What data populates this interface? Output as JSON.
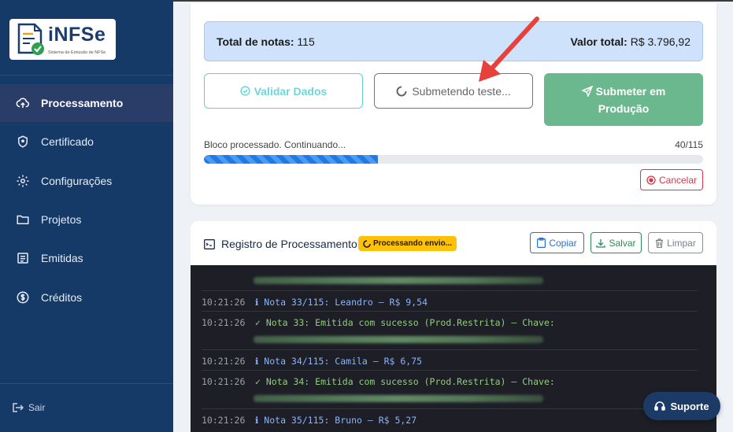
{
  "sidebar": {
    "logo": {
      "brand": "iNFSe",
      "subtitle": "Sistema de Emissão de NFSe"
    },
    "items": [
      {
        "label": "Processamento",
        "icon": "cloud-upload-icon",
        "active": true
      },
      {
        "label": "Certificado",
        "icon": "shield-icon"
      },
      {
        "label": "Configurações",
        "icon": "gear-icon"
      },
      {
        "label": "Projetos",
        "icon": "folder-icon"
      },
      {
        "label": "Emitidas",
        "icon": "list-icon"
      },
      {
        "label": "Créditos",
        "icon": "dollar-icon"
      }
    ],
    "logout_label": "Sair"
  },
  "summary": {
    "total_notas_label": "Total de notas:",
    "total_notas_value": "115",
    "valor_total_label": "Valor total:",
    "valor_total_value": "R$ 3.796,92"
  },
  "actions": {
    "validar_label": "Validar Dados",
    "teste_label": "Submetendo teste...",
    "producao_line1": "Submeter em",
    "producao_line2": "Produção"
  },
  "progress": {
    "status_text": "Bloco processado. Continuando...",
    "count_text": "40/115",
    "fraction": 0.348,
    "cancel_label": "Cancelar"
  },
  "log": {
    "title": "Registro de Processamento",
    "badge": "Processando envio...",
    "copy_label": "Copiar",
    "save_label": "Salvar",
    "clear_label": "Limpar",
    "entries": [
      {
        "time": "10:21:26",
        "type": "info",
        "text": "ℹ Nota 33/115: Leandro – R$ 9,54"
      },
      {
        "time": "10:21:26",
        "type": "ok",
        "text": "✓ Nota 33: Emitida com sucesso (Prod.Restrita) – Chave:"
      },
      {
        "time": "10:21:26",
        "type": "info",
        "text": "ℹ Nota 34/115: Camila – R$ 6,75"
      },
      {
        "time": "10:21:26",
        "type": "ok",
        "text": "✓ Nota 34: Emitida com sucesso (Prod.Restrita) – Chave:"
      },
      {
        "time": "10:21:26",
        "type": "info",
        "text": "ℹ Nota 35/115: Bruno – R$ 5,27"
      }
    ]
  },
  "support_label": "Suporte",
  "colors": {
    "sidebar_bg": "#163a68",
    "accent_blue": "#2a6fd6",
    "production_green": "#6cb88e",
    "warning_badge": "#ffc107",
    "danger": "#dc3545"
  }
}
